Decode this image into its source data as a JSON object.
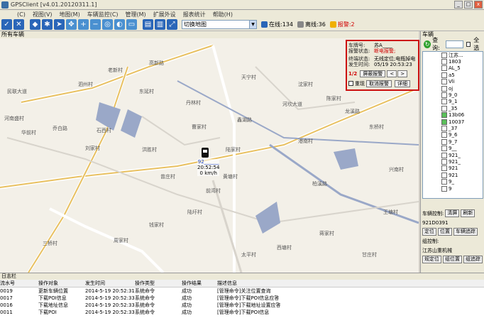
{
  "window": {
    "title": "GPSClient [v4.01.20120311.1]"
  },
  "menu": [
    "(C)",
    "视图(V)",
    "地图(M)",
    "车辆监控(C)",
    "管理(M)",
    "扩展外设",
    "报表统计",
    "帮助(H)"
  ],
  "toolbar": {
    "map_select": "切换地图",
    "online_label": "在线:134",
    "offline_label": "离线:36",
    "alarm_label": "报警:2",
    "colors": {
      "toolbar_icon": "#2a66b8",
      "alarm": "#d00000"
    }
  },
  "map": {
    "tab_label": "所有车辆",
    "labels": [
      "民联大道",
      "河南盛村",
      "华前村",
      "乔白路",
      "高新路",
      "泗州村",
      "老新村",
      "东延村",
      "丹林村",
      "曹家村",
      "河坎大道",
      "陈家村",
      "龙溪路",
      "石西村",
      "洪胜村",
      "陆家村",
      "黄塘村",
      "鑫湖路",
      "港南村",
      "柏溪路",
      "东桥村",
      "兴南村",
      "刘家村",
      "曾庄村",
      "前湾村",
      "陆圩村",
      "钱家村",
      "周家村",
      "三桥村",
      "太平村",
      "西塘村",
      "蒋家村",
      "甘庄村",
      "王塘村",
      "沈家村",
      "天宁村"
    ],
    "vehicle": {
      "plate": "92______",
      "time": "20:52:54",
      "speed": "0 km/h"
    }
  },
  "popup": {
    "plate_label": "车牌号:",
    "plate_value": "苏A____",
    "status_label": "报警状态:",
    "status_value": "断电报警;",
    "terminal_label": "终端状态:",
    "terminal_value": "无线定位;电瓶掉电",
    "time_label": "发生时间:",
    "time_value": "05/19 20:53:23",
    "page": "1/2",
    "mask_button": "屏蔽报警",
    "repeat_label": "重现",
    "cancel_button": "取消报警",
    "detail_button": "详细"
  },
  "sidebar": {
    "title": "车辆",
    "query_label": "查询:",
    "select_all_label": "全选",
    "vehicles": [
      "江苏...",
      "1803",
      "AL_5",
      "a5",
      "Vli",
      "oj",
      "9_0",
      "9_1",
      "_35",
      "13b06",
      "10037",
      "_37",
      "9_6",
      "9_7",
      "9__",
      "921_",
      "921_",
      "921",
      "921",
      "9_",
      "9"
    ],
    "control_label": "车辆控制:",
    "clear_button": "清屏",
    "refresh_button": "刷新",
    "selected_vehicle": "921D0391",
    "locate_button": "定位",
    "position_button": "位置",
    "track_button": "车辆追踪",
    "group_label": "组控制:",
    "group_value": "江苏山重机械",
    "regional_button": "规定位",
    "zone_button": "组位置",
    "group_track_button": "组追踪"
  },
  "log": {
    "title": "日志栏",
    "headers": [
      "流水号",
      "操作对象",
      "发生时间",
      "操作类型",
      "操作结果",
      "描述信息"
    ],
    "rows": [
      [
        "0019",
        "更新车辆位置",
        "2014-5-19 20:52:31",
        "系统命令",
        "成功",
        "[管理命令]关注位置查询"
      ],
      [
        "0017",
        "下载POI信息",
        "2014-5-19 20:52:33",
        "系统命令",
        "成功",
        "[管理命令]下载POI信息应答"
      ],
      [
        "0016",
        "下载地址信息",
        "2014-5-19 20:52:33",
        "系统命令",
        "成功",
        "[管理命令]下载地址设置应答"
      ],
      [
        "0011",
        "下载POI",
        "2014-5-19 20:52:33",
        "系统命令",
        "成功",
        "[管理命令]下载POI信息"
      ]
    ]
  }
}
